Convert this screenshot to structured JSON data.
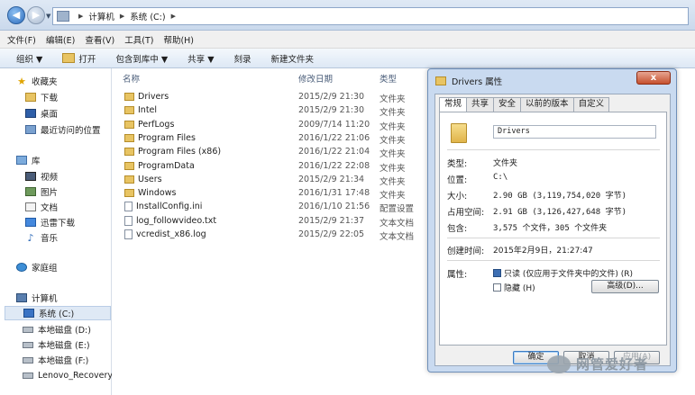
{
  "address": {
    "crumbs": [
      "计算机",
      "系统 (C:)"
    ]
  },
  "menu": [
    "文件(F)",
    "编辑(E)",
    "查看(V)",
    "工具(T)",
    "帮助(H)"
  ],
  "toolbar": {
    "organize": "组织 ▼",
    "open": "打开",
    "include": "包含到库中 ▼",
    "share": "共享 ▼",
    "burn": "刻录",
    "new_folder": "新建文件夹"
  },
  "nav": {
    "favorites": "收藏夹",
    "downloads": "下载",
    "desktop": "桌面",
    "recent": "最近访问的位置",
    "library": "库",
    "videos": "视频",
    "pictures": "图片",
    "documents": "文档",
    "thunder": "迅雷下载",
    "music": "音乐",
    "homegroup": "家庭组",
    "computer": "计算机",
    "drive_c": "系统 (C:)",
    "drive_d": "本地磁盘 (D:)",
    "drive_e": "本地磁盘 (E:)",
    "drive_f": "本地磁盘 (F:)",
    "drive_lenovo": "Lenovo_Recovery ("
  },
  "columns": {
    "name": "名称",
    "date": "修改日期",
    "type": "类型"
  },
  "files": [
    {
      "name": "Drivers",
      "date": "2015/2/9 21:30",
      "type": "文件夹",
      "kind": "folder"
    },
    {
      "name": "Intel",
      "date": "2015/2/9 21:30",
      "type": "文件夹",
      "kind": "folder"
    },
    {
      "name": "PerfLogs",
      "date": "2009/7/14 11:20",
      "type": "文件夹",
      "kind": "folder"
    },
    {
      "name": "Program Files",
      "date": "2016/1/22 21:06",
      "type": "文件夹",
      "kind": "folder"
    },
    {
      "name": "Program Files (x86)",
      "date": "2016/1/22 21:04",
      "type": "文件夹",
      "kind": "folder"
    },
    {
      "name": "ProgramData",
      "date": "2016/1/22 22:08",
      "type": "文件夹",
      "kind": "folder"
    },
    {
      "name": "Users",
      "date": "2015/2/9 21:34",
      "type": "文件夹",
      "kind": "folder"
    },
    {
      "name": "Windows",
      "date": "2016/1/31 17:48",
      "type": "文件夹",
      "kind": "folder"
    },
    {
      "name": "InstallConfig.ini",
      "date": "2016/1/10 21:56",
      "type": "配置设置",
      "kind": "file"
    },
    {
      "name": "log_followvideo.txt",
      "date": "2015/2/9 21:37",
      "type": "文本文档",
      "kind": "file"
    },
    {
      "name": "vcredist_x86.log",
      "date": "2015/2/9 22:05",
      "type": "文本文档",
      "kind": "file"
    }
  ],
  "dialog": {
    "title": "Drivers 属性",
    "close": "x",
    "tabs": [
      "常规",
      "共享",
      "安全",
      "以前的版本",
      "自定义"
    ],
    "name": "Drivers",
    "type_label": "类型:",
    "type_value": "文件夹",
    "location_label": "位置:",
    "location_value": "C:\\",
    "size_label": "大小:",
    "size_value": "2.90 GB (3,119,754,020 字节)",
    "disk_label": "占用空间:",
    "disk_value": "2.91 GB (3,126,427,648 字节)",
    "contains_label": "包含:",
    "contains_value": "3,575 个文件，305 个文件夹",
    "created_label": "创建时间:",
    "created_value": "2015年2月9日，21:27:47",
    "attrs_label": "属性:",
    "readonly": "只读 (仅应用于文件夹中的文件) (R)",
    "hidden": "隐藏 (H)",
    "advanced": "高级(D)...",
    "ok": "确定",
    "cancel": "取消",
    "apply": "应用(A)"
  },
  "watermark": "网管爱好者"
}
